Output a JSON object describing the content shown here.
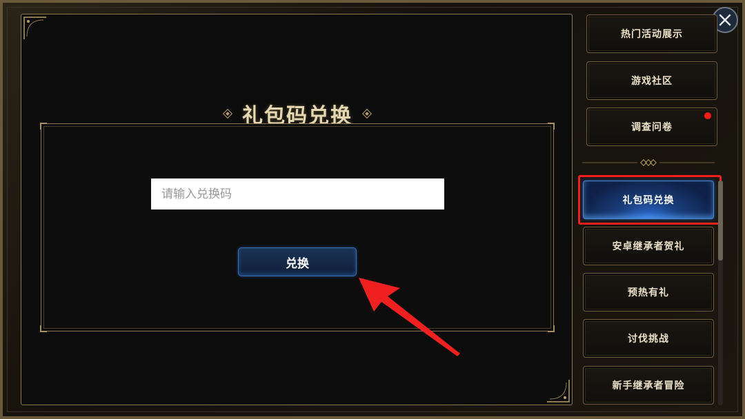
{
  "page": {
    "title": "礼包码兑换"
  },
  "form": {
    "code_placeholder": "请输入兑换码",
    "redeem_label": "兑换"
  },
  "sidebar": {
    "items": [
      {
        "label": "热门活动展示",
        "active": false,
        "badge": false
      },
      {
        "label": "游戏社区",
        "active": false,
        "badge": false
      },
      {
        "label": "调查问卷",
        "active": false,
        "badge": true
      },
      {
        "label": "礼包码兑换",
        "active": true,
        "badge": false
      },
      {
        "label": "安卓继承者贺礼",
        "active": false,
        "badge": false
      },
      {
        "label": "预热有礼",
        "active": false,
        "badge": false
      },
      {
        "label": "讨伐挑战",
        "active": false,
        "badge": false
      },
      {
        "label": "新手继承者冒险",
        "active": false,
        "badge": false
      }
    ]
  },
  "icons": {
    "close": "close-icon",
    "notification": "red-dot-badge"
  },
  "colors": {
    "accent_gold": "#b89d66",
    "active_blue": "#1a3e7c",
    "highlight_red": "#f21e1e",
    "badge_red": "#ff1a1a"
  }
}
